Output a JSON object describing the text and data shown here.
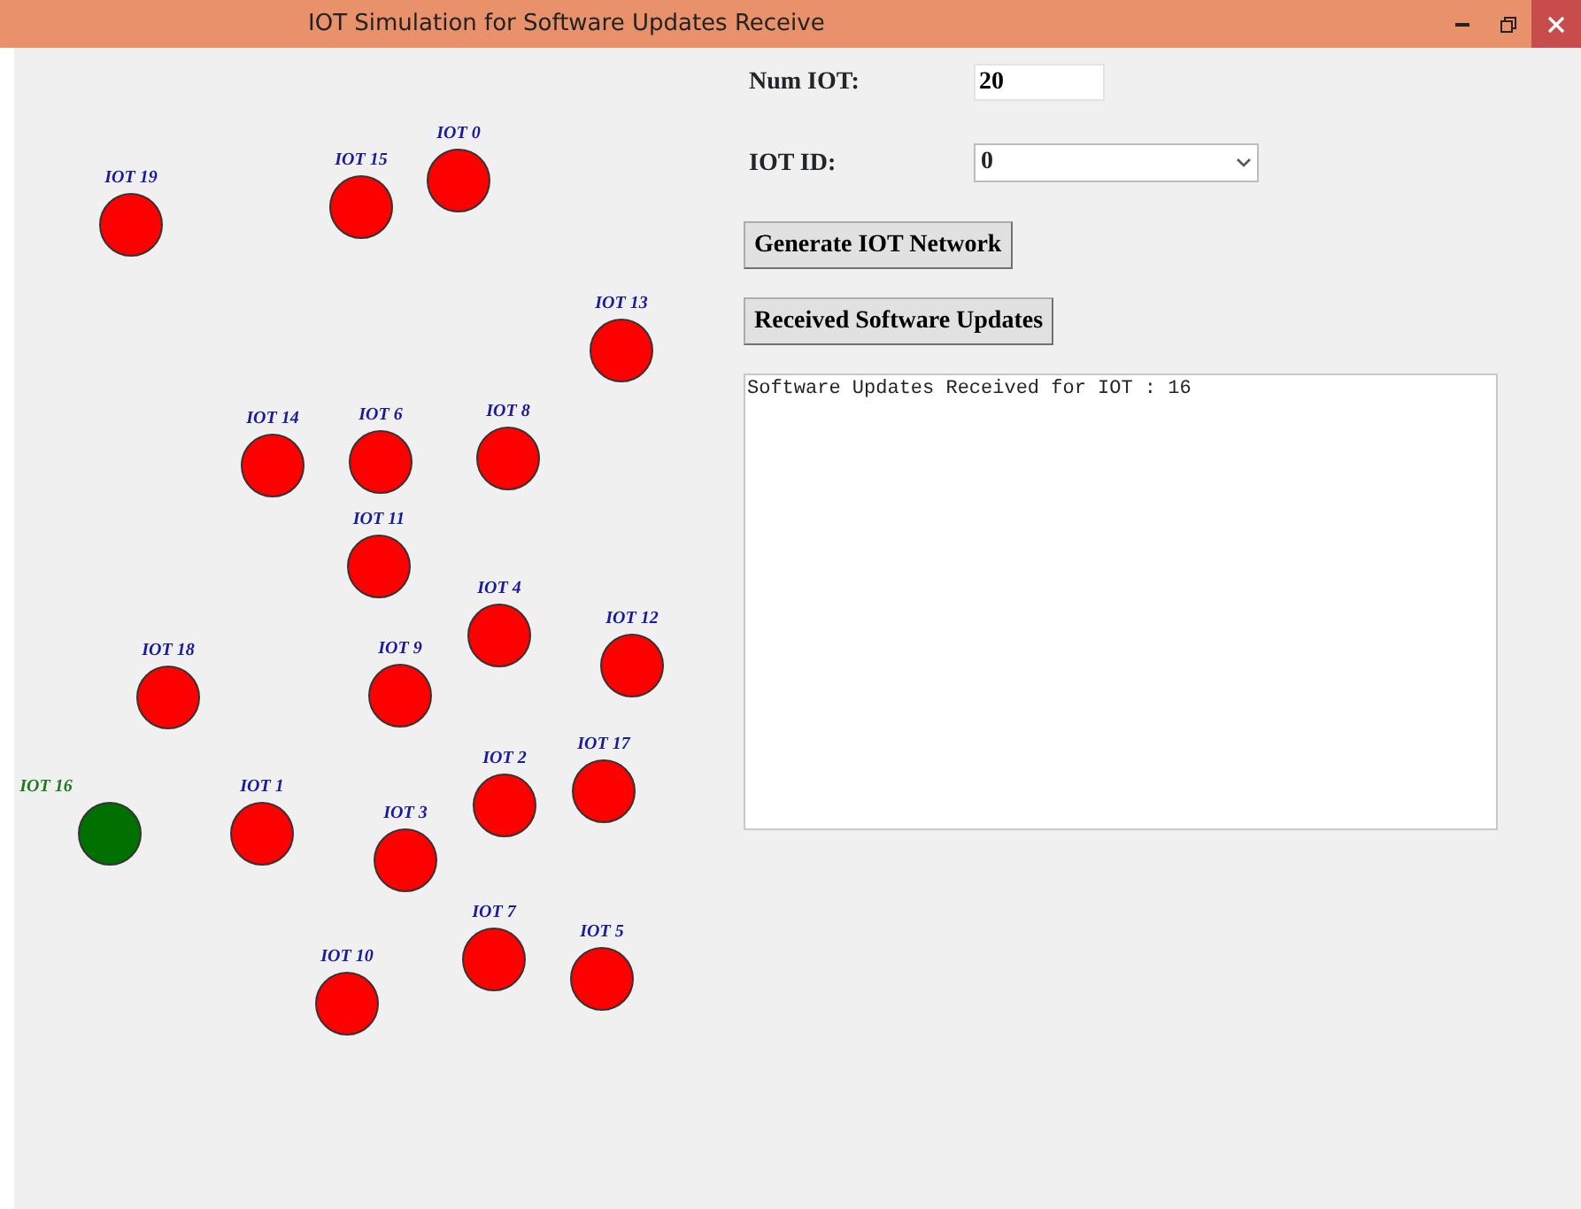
{
  "window": {
    "title": "IOT Simulation for Software Updates Receive"
  },
  "form": {
    "num_iot_label": "Num IOT:",
    "num_iot_value": "20",
    "iot_id_label": "IOT ID:",
    "iot_id_value": "0"
  },
  "buttons": [
    "Generate IOT Network",
    "Received Software Updates"
  ],
  "output": "Software Updates Received for IOT : 16",
  "nodes": [
    {
      "label": "IOT 19",
      "color": "#ff0000",
      "updated": false
    },
    {
      "label": "IOT 15",
      "color": "#ff0000",
      "updated": false
    },
    {
      "label": "IOT 0",
      "color": "#ff0000",
      "updated": false
    },
    {
      "label": "IOT 13",
      "color": "#ff0000",
      "updated": false
    },
    {
      "label": "IOT 14",
      "color": "#ff0000",
      "updated": false
    },
    {
      "label": "IOT 6",
      "color": "#ff0000",
      "updated": false
    },
    {
      "label": "IOT 8",
      "color": "#ff0000",
      "updated": false
    },
    {
      "label": "IOT 11",
      "color": "#ff0000",
      "updated": false
    },
    {
      "label": "IOT 4",
      "color": "#ff0000",
      "updated": false
    },
    {
      "label": "IOT 12",
      "color": "#ff0000",
      "updated": false
    },
    {
      "label": "IOT 18",
      "color": "#ff0000",
      "updated": false
    },
    {
      "label": "IOT 9",
      "color": "#ff0000",
      "updated": false
    },
    {
      "label": "IOT 16",
      "color": "#007000",
      "updated": true
    },
    {
      "label": "IOT 1",
      "color": "#ff0000",
      "updated": false
    },
    {
      "label": "IOT 3",
      "color": "#ff0000",
      "updated": false
    },
    {
      "label": "IOT 2",
      "color": "#ff0000",
      "updated": false
    },
    {
      "label": "IOT 17",
      "color": "#ff0000",
      "updated": false
    },
    {
      "label": "IOT 7",
      "color": "#ff0000",
      "updated": false
    },
    {
      "label": "IOT 5",
      "color": "#ff0000",
      "updated": false
    },
    {
      "label": "IOT 10",
      "color": "#ff0000",
      "updated": false
    }
  ]
}
